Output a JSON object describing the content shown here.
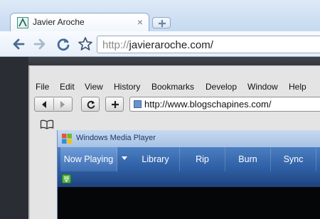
{
  "chrome": {
    "tab": {
      "title": "Javier Aroche",
      "close_glyph": "×",
      "favicon": "aroche-logo-icon"
    },
    "newtab_icon": "plus-icon",
    "toolbar": {
      "back_icon": "arrow-left-icon",
      "forward_icon": "arrow-right-icon",
      "reload_icon": "reload-icon",
      "star_icon": "star-icon"
    },
    "omnibox": {
      "protocol": "http://",
      "host": "javieraroche.com/"
    }
  },
  "inner_browser": {
    "menu": [
      "File",
      "Edit",
      "View",
      "History",
      "Bookmarks",
      "Develop",
      "Window",
      "Help"
    ],
    "url": "http://www.blogschapines.com/",
    "toolbar_icons": [
      "back-icon",
      "forward-icon",
      "reload-icon",
      "add-icon"
    ],
    "bookmarks_icon": "book-icon"
  },
  "media_player": {
    "title": "Windows Media Player",
    "tabs": [
      "Now Playing",
      "Library",
      "Rip",
      "Burn",
      "Sync"
    ],
    "active_tab": "Now Playing",
    "colors": {
      "nav": "#3564a9",
      "title_bar": "#b7cdea",
      "video": "#050608"
    }
  }
}
